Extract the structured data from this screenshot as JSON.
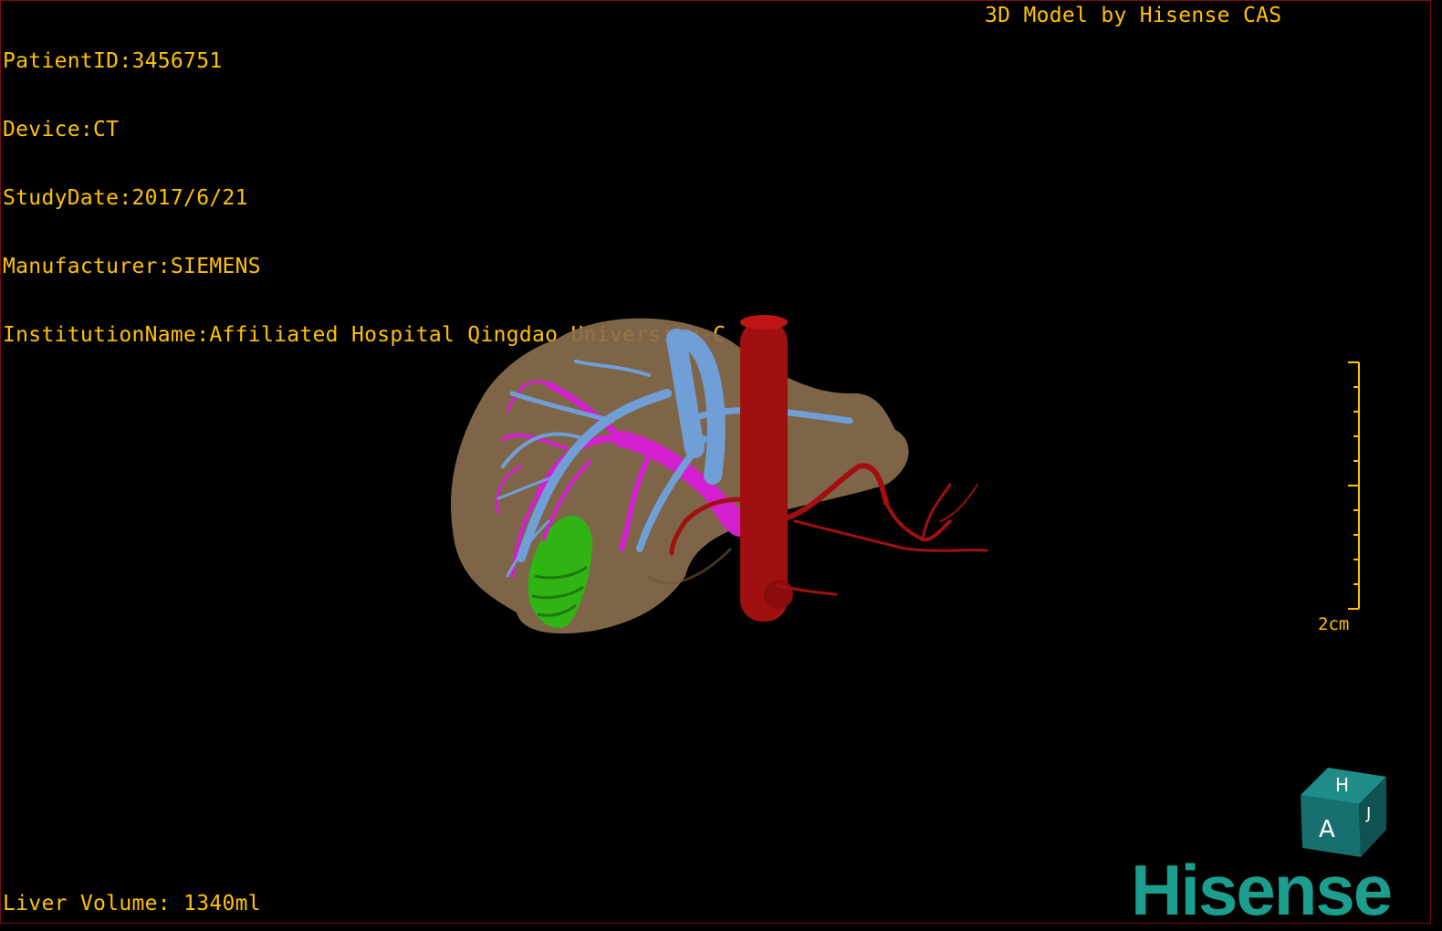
{
  "header": {
    "patient_id": "PatientID:3456751",
    "device": "Device:CT",
    "study_date": "StudyDate:2017/6/21",
    "manufacturer": "Manufacturer:SIEMENS",
    "institution": "InstitutionName:Affiliated Hospital Qingdao University-C",
    "model_credit": "3D Model by Hisense CAS"
  },
  "footer": {
    "liver_volume": "Liver Volume: 1340ml"
  },
  "scale": {
    "label": "2cm"
  },
  "orientation_cube": {
    "top_letter": "H",
    "front_letter": "A",
    "side_letter": "J"
  },
  "brand": {
    "name": "Hisense"
  },
  "colors": {
    "text": "#ffc200",
    "liver": "#8a6e4e",
    "hepatic_vein": "#6f9fd6",
    "portal_vein": "#d41fd0",
    "artery": "#a01010",
    "gallbladder": "#2fb414",
    "brand": "#1b9e8e"
  },
  "structures": [
    "liver",
    "hepatic-veins",
    "portal-vein",
    "hepatic-artery",
    "aorta",
    "gallbladder"
  ]
}
